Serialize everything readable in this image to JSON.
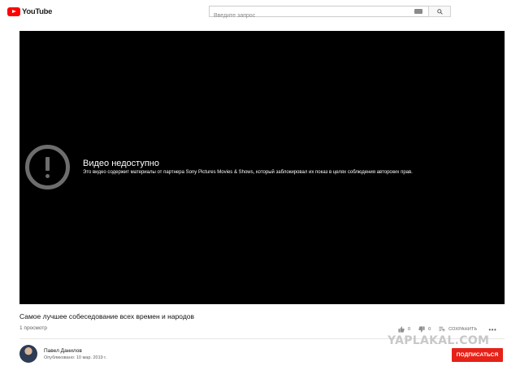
{
  "header": {
    "logo_text": "YouTube",
    "search_placeholder": "Введите запрос"
  },
  "player": {
    "error_title": "Видео недоступно",
    "error_message": "Это видео содержит материалы от партнера Sony Pictures Movies & Shows, который заблокировал их показ в целях соблюдения авторских прав."
  },
  "video": {
    "title": "Самое лучшее собеседование всех времен и народов",
    "views": "1 просмотр",
    "likes": "0",
    "dislikes": "0",
    "save_label": "СОХРАНИТЬ",
    "more_label": "•••"
  },
  "channel": {
    "name": "Павел Данилов",
    "published": "Опубликовано: 10 мар. 2019 г.",
    "subscribe_label": "ПОДПИСАТЬСЯ"
  },
  "watermark": "YAPLAKAL.COM",
  "colors": {
    "brand_red": "#ff0000",
    "subscribe_red": "#e62117",
    "player_bg": "#000000"
  }
}
